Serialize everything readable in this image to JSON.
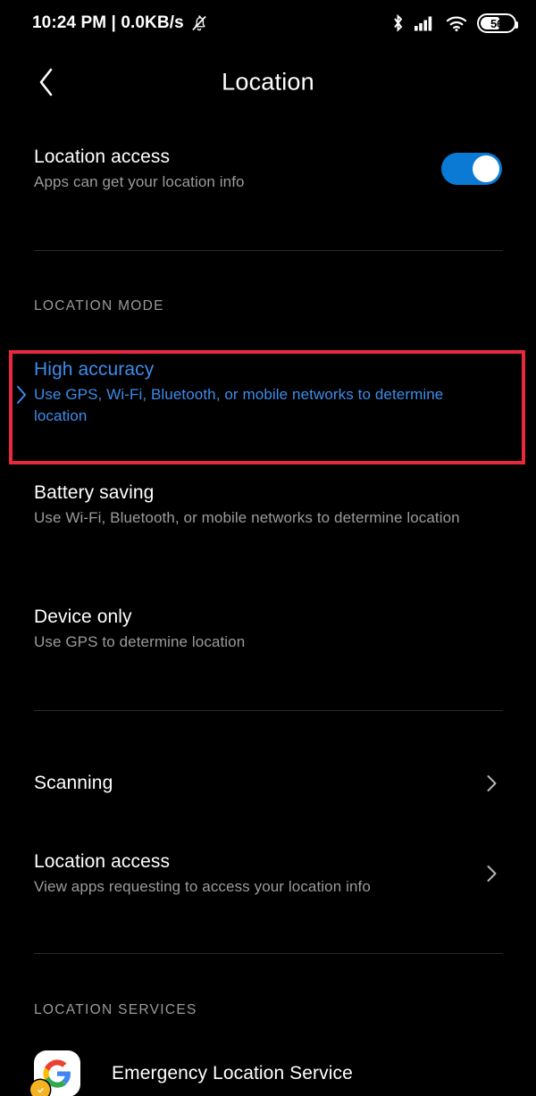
{
  "status_bar": {
    "clock": "10:24 PM | 0.0KB/s",
    "mute_icon": "bell-muted-icon",
    "bluetooth_icon": "bluetooth-icon",
    "signal_icon": "cellular-signal-icon",
    "wifi_icon": "wifi-icon",
    "battery_level": "56"
  },
  "header": {
    "back_icon": "chevron-left-icon",
    "title": "Location"
  },
  "location_access_toggle": {
    "title": "Location access",
    "subtitle": "Apps can get your location info",
    "enabled": true
  },
  "location_mode": {
    "section_label": "LOCATION MODE",
    "options": [
      {
        "title": "High accuracy",
        "subtitle": "Use GPS, Wi-Fi, Bluetooth, or mobile networks to determine location",
        "selected": true
      },
      {
        "title": "Battery saving",
        "subtitle": "Use Wi-Fi, Bluetooth, or mobile networks to determine location",
        "selected": false
      },
      {
        "title": "Device only",
        "subtitle": "Use GPS to determine location",
        "selected": false
      }
    ]
  },
  "nav_rows": [
    {
      "title": "Scanning",
      "subtitle": "",
      "chevron": "chevron-right-icon"
    },
    {
      "title": "Location access",
      "subtitle": "View apps requesting to access your location info",
      "chevron": "chevron-right-icon"
    }
  ],
  "location_services": {
    "section_label": "LOCATION SERVICES",
    "items": [
      {
        "title": "Emergency Location Service",
        "icon": "google-logo-icon"
      }
    ]
  },
  "colors": {
    "background": "#000000",
    "accent_blue": "#3d8ceb",
    "toggle_blue": "#0b7ad4",
    "highlight_red": "#e8283c",
    "secondary_text": "#9b9b9b",
    "primary_text": "#ffffff"
  }
}
